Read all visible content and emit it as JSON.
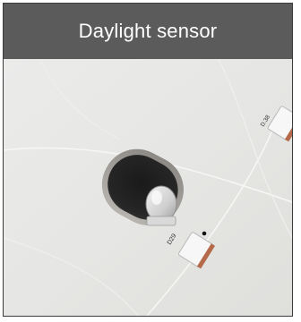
{
  "caption": {
    "title": "Daylight sensor"
  },
  "photo": {
    "component_labels": [
      "D29",
      "D.38"
    ]
  },
  "colors": {
    "caption_background": "#5b5b5b",
    "caption_text": "#ffffff",
    "board_surface": "#e7e7e5",
    "frame_border": "#3c3c3c"
  }
}
